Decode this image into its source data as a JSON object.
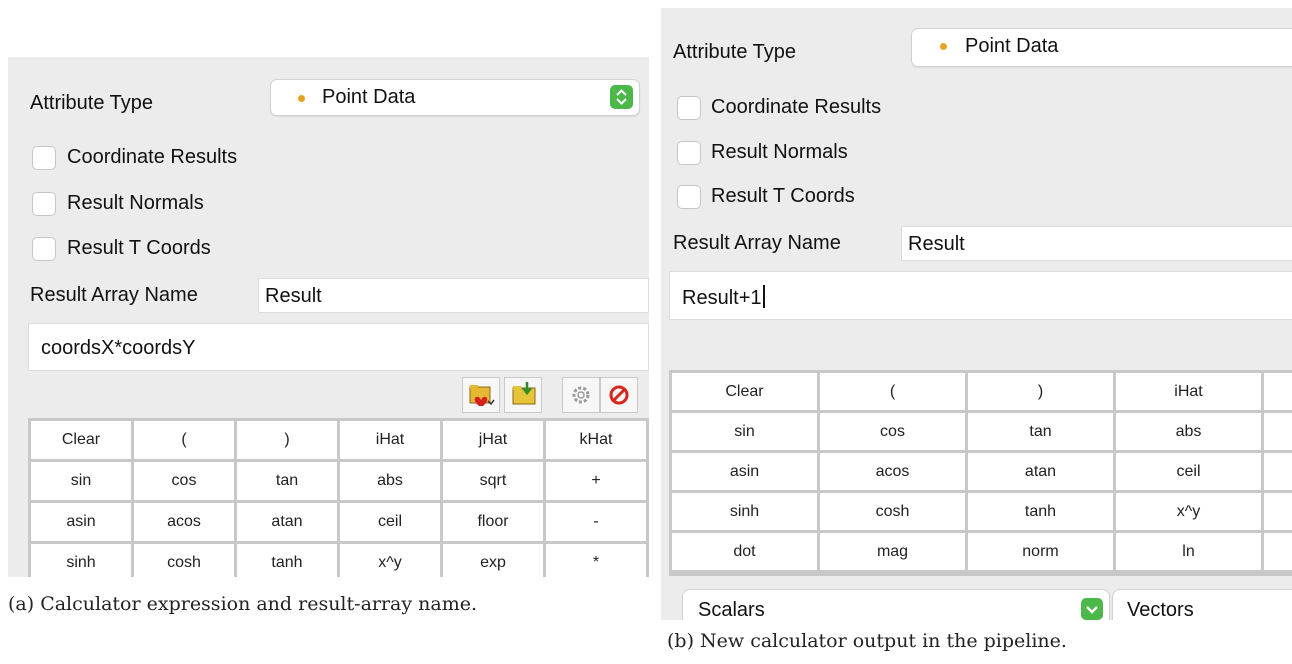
{
  "left": {
    "attribute_type_label": "Attribute Type",
    "attribute_type_value": "Point Data",
    "checkboxes": [
      "Coordinate Results",
      "Result Normals",
      "Result T Coords"
    ],
    "result_array_label": "Result Array Name",
    "result_array_value": "Result",
    "expression": "coordsX*coordsY",
    "keypad": [
      [
        "Clear",
        "(",
        ")",
        "iHat",
        "jHat",
        "kHat"
      ],
      [
        "sin",
        "cos",
        "tan",
        "abs",
        "sqrt",
        "+"
      ],
      [
        "asin",
        "acos",
        "atan",
        "ceil",
        "floor",
        "-"
      ],
      [
        "sinh",
        "cosh",
        "tanh",
        "x^y",
        "exp",
        "*"
      ]
    ],
    "caption": "(a) Calculator expression and result-array name."
  },
  "right": {
    "attribute_type_label": "Attribute Type",
    "attribute_type_value": "Point Data",
    "checkboxes": [
      "Coordinate Results",
      "Result Normals",
      "Result T Coords"
    ],
    "result_array_label": "Result Array Name",
    "result_array_value": "Result",
    "expression": "Result+1",
    "keypad": [
      [
        "Clear",
        "(",
        ")",
        "iHat"
      ],
      [
        "sin",
        "cos",
        "tan",
        "abs"
      ],
      [
        "asin",
        "acos",
        "atan",
        "ceil"
      ],
      [
        "sinh",
        "cosh",
        "tanh",
        "x^y"
      ],
      [
        "dot",
        "mag",
        "norm",
        "ln"
      ]
    ],
    "scalars_label": "Scalars",
    "vectors_label": "Vectors",
    "caption": "(b) New calculator output in the pipeline."
  },
  "colors": {
    "panel_bg": "#ececec",
    "dot": "#e7a224",
    "combo_arrow": "#4cb84a",
    "no_icon": "#d7261e"
  },
  "icons": [
    "folder-favorite-icon",
    "folder-import-icon",
    "gear-icon",
    "no-entry-icon",
    "combo-arrows-icon",
    "chevron-down-icon"
  ]
}
